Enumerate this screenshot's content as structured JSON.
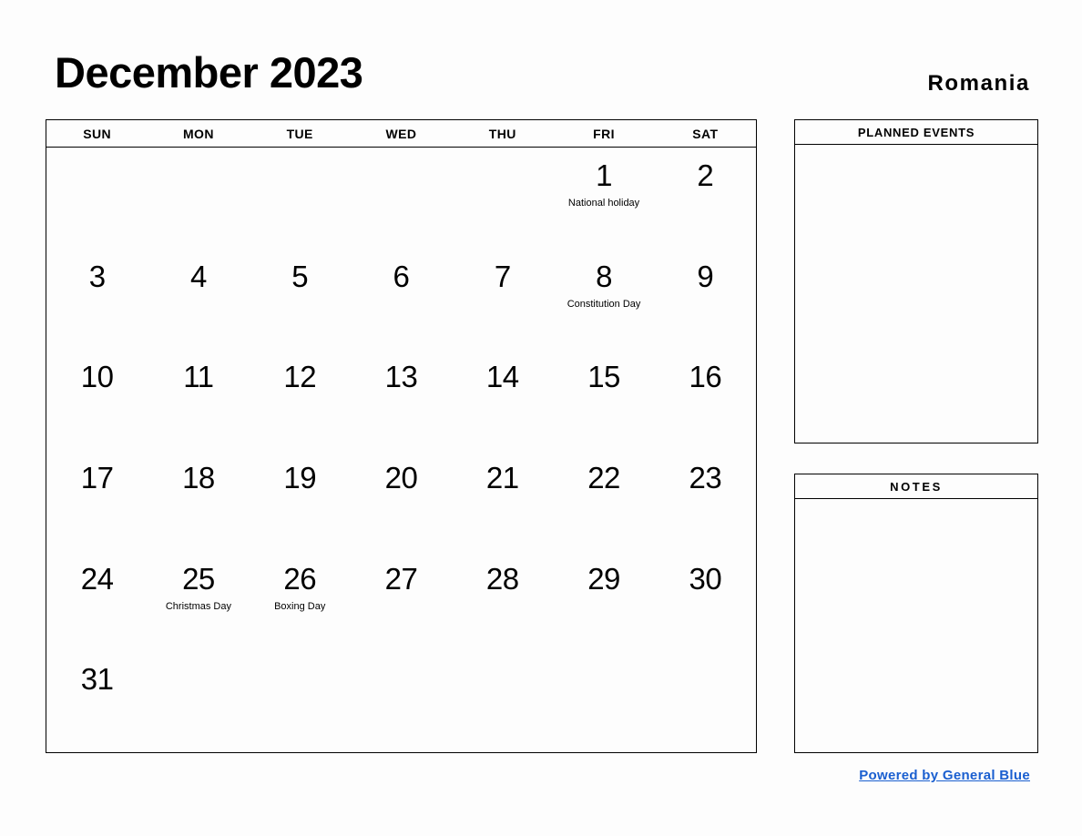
{
  "header": {
    "title": "December 2023",
    "country": "Romania"
  },
  "calendar": {
    "weekdays": [
      "SUN",
      "MON",
      "TUE",
      "WED",
      "THU",
      "FRI",
      "SAT"
    ],
    "weeks": [
      [
        {
          "day": "",
          "event": ""
        },
        {
          "day": "",
          "event": ""
        },
        {
          "day": "",
          "event": ""
        },
        {
          "day": "",
          "event": ""
        },
        {
          "day": "",
          "event": ""
        },
        {
          "day": "1",
          "event": "National holiday"
        },
        {
          "day": "2",
          "event": ""
        }
      ],
      [
        {
          "day": "3",
          "event": ""
        },
        {
          "day": "4",
          "event": ""
        },
        {
          "day": "5",
          "event": ""
        },
        {
          "day": "6",
          "event": ""
        },
        {
          "day": "7",
          "event": ""
        },
        {
          "day": "8",
          "event": "Constitution Day"
        },
        {
          "day": "9",
          "event": ""
        }
      ],
      [
        {
          "day": "10",
          "event": ""
        },
        {
          "day": "11",
          "event": ""
        },
        {
          "day": "12",
          "event": ""
        },
        {
          "day": "13",
          "event": ""
        },
        {
          "day": "14",
          "event": ""
        },
        {
          "day": "15",
          "event": ""
        },
        {
          "day": "16",
          "event": ""
        }
      ],
      [
        {
          "day": "17",
          "event": ""
        },
        {
          "day": "18",
          "event": ""
        },
        {
          "day": "19",
          "event": ""
        },
        {
          "day": "20",
          "event": ""
        },
        {
          "day": "21",
          "event": ""
        },
        {
          "day": "22",
          "event": ""
        },
        {
          "day": "23",
          "event": ""
        }
      ],
      [
        {
          "day": "24",
          "event": ""
        },
        {
          "day": "25",
          "event": "Christmas Day"
        },
        {
          "day": "26",
          "event": "Boxing Day"
        },
        {
          "day": "27",
          "event": ""
        },
        {
          "day": "28",
          "event": ""
        },
        {
          "day": "29",
          "event": ""
        },
        {
          "day": "30",
          "event": ""
        }
      ],
      [
        {
          "day": "31",
          "event": ""
        },
        {
          "day": "",
          "event": ""
        },
        {
          "day": "",
          "event": ""
        },
        {
          "day": "",
          "event": ""
        },
        {
          "day": "",
          "event": ""
        },
        {
          "day": "",
          "event": ""
        },
        {
          "day": "",
          "event": ""
        }
      ]
    ]
  },
  "panels": {
    "planned_events": {
      "title": "PLANNED EVENTS",
      "content": ""
    },
    "notes": {
      "title": "NOTES",
      "content": ""
    }
  },
  "footer": {
    "link_text": "Powered by General Blue",
    "link_color": "#1a5fd0"
  }
}
